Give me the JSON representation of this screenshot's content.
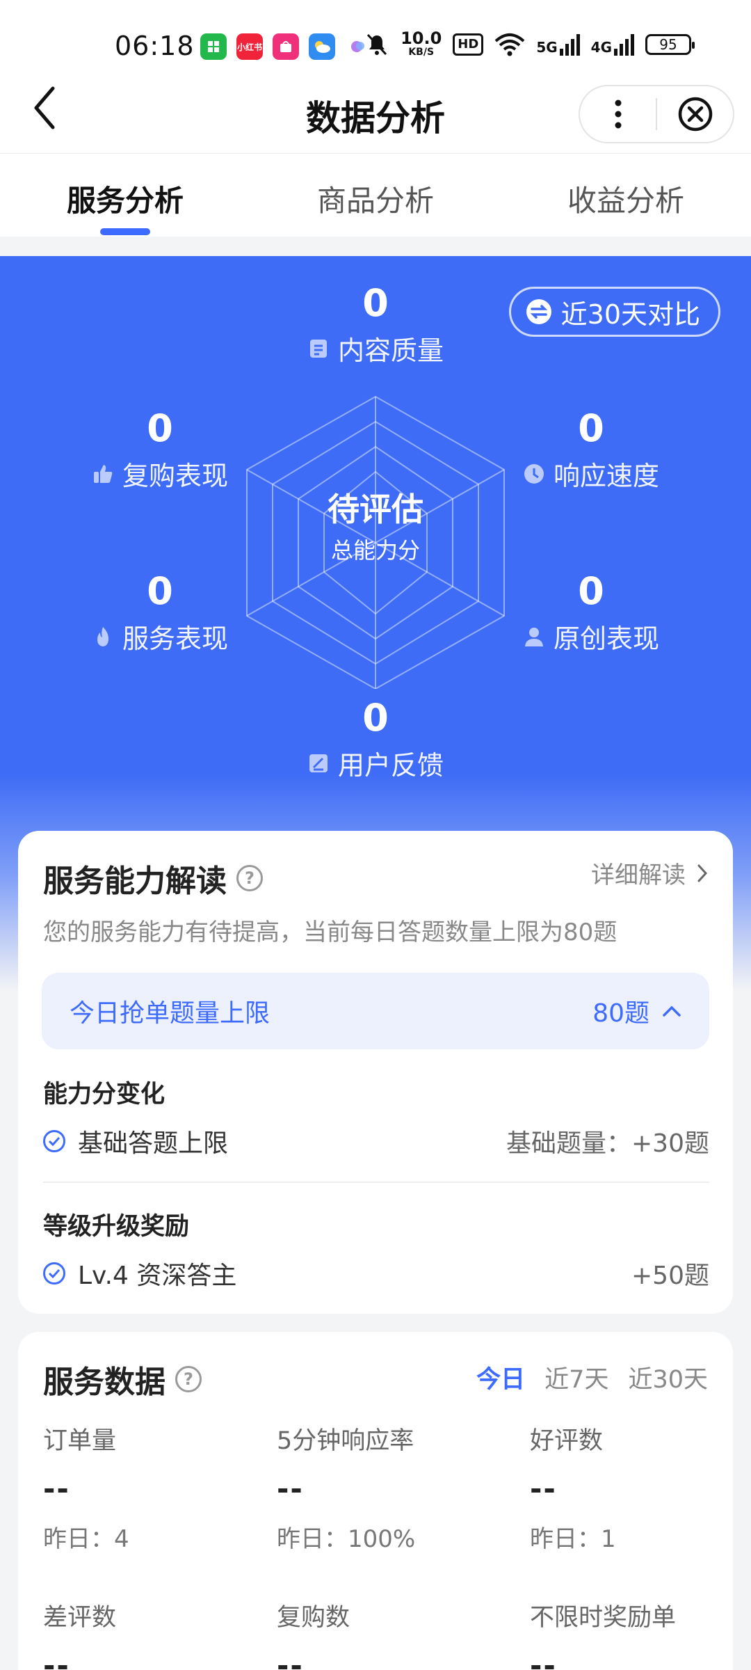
{
  "status_bar": {
    "time": "06:18",
    "apps": [
      {
        "icon": "wechat-mini-icon",
        "label": "",
        "color": "#22b84c"
      },
      {
        "icon": "xiaohongshu-icon",
        "label": "小红书",
        "color": "#f0233a"
      },
      {
        "icon": "shopping-icon",
        "label": "",
        "color": "#f0307a"
      },
      {
        "icon": "weather-icon",
        "label": "",
        "color": "#2f8cf0"
      },
      {
        "icon": "assistant-icon",
        "label": "",
        "color": "#b47cf0"
      }
    ],
    "net_speed": "10.0",
    "net_unit": "KB/S",
    "hd_label": "HD",
    "sig1": "5G",
    "sig2": "4G",
    "battery": "95"
  },
  "header": {
    "title": "数据分析"
  },
  "tabs": [
    {
      "label": "服务分析",
      "active": true
    },
    {
      "label": "商品分析",
      "active": false
    },
    {
      "label": "收益分析",
      "active": false
    }
  ],
  "hero": {
    "compare_label": "近30天对比",
    "center_title": "待评估",
    "center_sub": "总能力分",
    "metrics": {
      "content_quality": {
        "value": "0",
        "label": "内容质量"
      },
      "response_speed": {
        "value": "0",
        "label": "响应速度"
      },
      "original": {
        "value": "0",
        "label": "原创表现"
      },
      "feedback": {
        "value": "0",
        "label": "用户反馈"
      },
      "service": {
        "value": "0",
        "label": "服务表现"
      },
      "repurchase": {
        "value": "0",
        "label": "复购表现"
      }
    }
  },
  "ability_card": {
    "title": "服务能力解读",
    "detail_link": "详细解读",
    "description": "您的服务能力有待提高，当前每日答题数量上限为80题",
    "limit_label": "今日抢单题量上限",
    "limit_value": "80题",
    "change_title": "能力分变化",
    "base_row": {
      "label": "基础答题上限",
      "value": "基础题量：+30题"
    },
    "level_title": "等级升级奖励",
    "level_row": {
      "label": "Lv.4 资深答主",
      "value": "+50题"
    }
  },
  "service_data": {
    "title": "服务数据",
    "periods": [
      "今日",
      "近7天",
      "近30天"
    ],
    "stats": [
      {
        "name": "订单量",
        "value": "--",
        "prev": "昨日：4"
      },
      {
        "name": "5分钟响应率",
        "value": "--",
        "prev": "昨日：100%"
      },
      {
        "name": "好评数",
        "value": "--",
        "prev": "昨日：1"
      },
      {
        "name": "差评数",
        "value": "--",
        "prev": ""
      },
      {
        "name": "复购数",
        "value": "--",
        "prev": ""
      },
      {
        "name": "不限时奖励单",
        "value": "--",
        "prev": ""
      }
    ]
  },
  "colors": {
    "accent": "#3d6bff",
    "hero_blue": "#3e6cf6"
  }
}
